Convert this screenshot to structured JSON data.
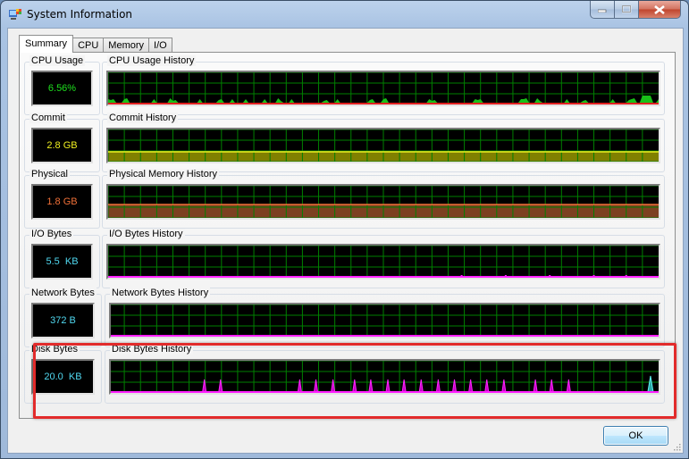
{
  "window": {
    "title": "System Information",
    "controls": {
      "minimize": "minimize-icon",
      "maximize": "maximize-icon",
      "close": "close-icon"
    }
  },
  "tabs": [
    {
      "label": "Summary",
      "active": true
    },
    {
      "label": "CPU",
      "active": false
    },
    {
      "label": "Memory",
      "active": false
    },
    {
      "label": "I/O",
      "active": false
    }
  ],
  "panels": [
    {
      "id": "cpu",
      "value_label": "CPU Usage",
      "value": "6.56%",
      "value_color": "#1ee01e",
      "history_label": "CPU Usage History",
      "fill": "#18c018",
      "line": "#e02020",
      "type": "cpu"
    },
    {
      "id": "commit",
      "value_label": "Commit",
      "value": "2.8 GB",
      "value_color": "#f0f020",
      "history_label": "Commit History",
      "fill": "#808000",
      "line": "#f0f020",
      "type": "level",
      "level": 0.3
    },
    {
      "id": "physical",
      "value_label": "Physical",
      "value": "1.8 GB",
      "value_color": "#f07038",
      "history_label": "Physical Memory History",
      "fill": "#7c4020",
      "line": "#f07038",
      "type": "level",
      "level": 0.42
    },
    {
      "id": "io",
      "value_label": "I/O Bytes",
      "value": "5.5  KB",
      "value_color": "#50d8f0",
      "history_label": "I/O Bytes History",
      "fill": "#c000c0",
      "line": "#ff20ff",
      "type": "io"
    },
    {
      "id": "network",
      "value_label": "Network Bytes",
      "value": "372 B",
      "value_color": "#50d8f0",
      "history_label": "Network Bytes History",
      "fill": "#c000c0",
      "line": "#ff20ff",
      "type": "flat"
    },
    {
      "id": "disk",
      "value_label": "Disk Bytes",
      "value": "20.0  KB",
      "value_color": "#50d8f0",
      "history_label": "Disk Bytes History",
      "fill": "#c000c0",
      "line": "#ff20ff",
      "type": "disk",
      "highlighted": true
    }
  ],
  "colors": {
    "grid": "#008000",
    "highlight": "#e22b2b"
  },
  "buttons": {
    "ok": "OK"
  }
}
